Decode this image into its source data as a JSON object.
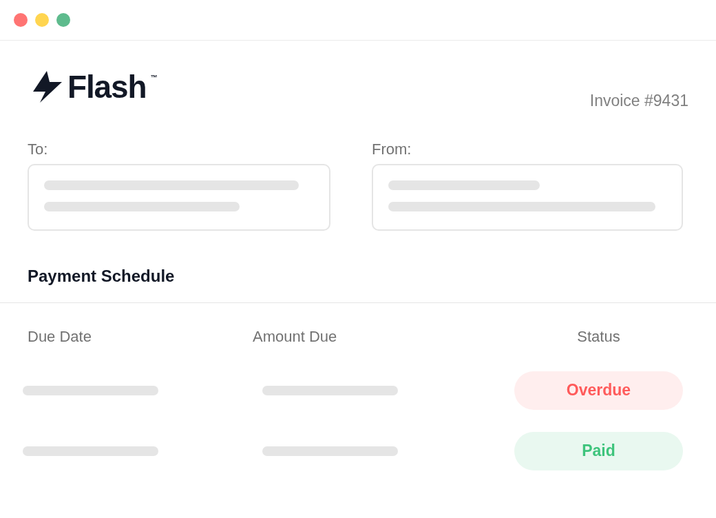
{
  "logo": {
    "name": "Flash",
    "mark": "™"
  },
  "invoice_number": "Invoice #9431",
  "parties": [
    {
      "label": "To:"
    },
    {
      "label": "From:"
    }
  ],
  "section_title": "Payment Schedule",
  "table": {
    "columns": [
      "Due Date",
      "Amount Due",
      "Status"
    ],
    "rows": [
      {
        "status": "Overdue",
        "kind": "overdue"
      },
      {
        "status": "Paid",
        "kind": "paid"
      }
    ]
  }
}
